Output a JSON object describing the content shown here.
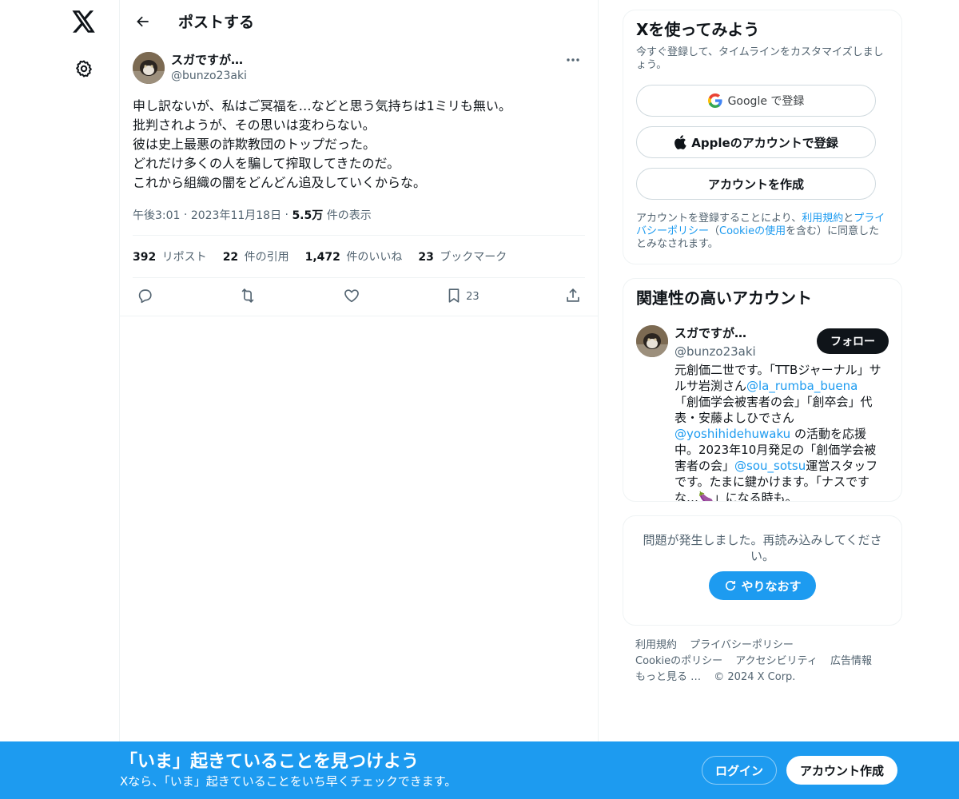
{
  "nav": {
    "logo_icon": "x-logo-icon",
    "settings_icon": "gear-icon"
  },
  "header": {
    "title": "ポストする"
  },
  "post": {
    "display_name": "スガですが…",
    "handle": "@bunzo23aki",
    "body": "申し訳ないが、私はご冥福を…などと思う気持ちは1ミリも無い。\n批判されようが、その思いは変わらない。\n彼は史上最悪の詐欺教団のトップだった。\nどれだけ多くの人を騙して搾取してきたのだ。\nこれから組織の闇をどんどん追及していくからな。",
    "time": "午後3:01",
    "date": "2023年11月18日",
    "views_value": "5.5万",
    "views_label": "件の表示",
    "reposts_value": "392",
    "reposts_label": "リポスト",
    "quotes_value": "22",
    "quotes_label": "件の引用",
    "likes_value": "1,472",
    "likes_label": "件のいいね",
    "bookmarks_value": "23",
    "bookmarks_label": "ブックマーク",
    "bookmark_action_count": "23"
  },
  "signup": {
    "title": "Xを使ってみよう",
    "subtitle": "今すぐ登録して、タイムラインをカスタマイズしましょう。",
    "google_label": "Google で登録",
    "apple_label": "Appleのアカウントで登録",
    "create_label": "アカウントを作成",
    "legal_1": "アカウントを登録することにより、",
    "legal_terms": "利用規約",
    "legal_and": "と",
    "legal_privacy": "プライバシーポリシー",
    "legal_open": "（",
    "legal_cookie": "Cookieの使用",
    "legal_2": "を含む）に同意したとみなされます。"
  },
  "related": {
    "title": "関連性の高いアカウント",
    "name": "スガですが…",
    "handle": "@bunzo23aki",
    "follow_label": "フォロー",
    "bio_1": "元創価二世です。「TTBジャーナル」サルサ岩渕さん",
    "bio_mention_1": "@la_rumba_buena",
    "bio_2": " 「創価学会被害者の会」「創卒会」代表・安藤よしひでさん",
    "bio_mention_2": "@yoshihidehuwaku",
    "bio_3": " の活動を応援中。2023年10月発足の「創価学会被害者の会」",
    "bio_mention_3": "@sou_sotsu",
    "bio_4": "運営スタッフです。たまに鍵かけます。「ナスですな…🍆」になる時も。"
  },
  "error": {
    "message": "問題が発生しました。再読み込みしてください。",
    "retry_label": "やりなおす"
  },
  "footer": {
    "terms": "利用規約",
    "privacy": "プライバシーポリシー",
    "cookie": "Cookieのポリシー",
    "accessibility": "アクセシビリティ",
    "ads": "広告情報",
    "more": "もっと見る …",
    "copyright": "© 2024 X Corp."
  },
  "banner": {
    "title": "「いま」起きていることを見つけよう",
    "subtitle": "Xなら、「いま」起きていることをいち早くチェックできます。",
    "login_label": "ログイン",
    "signup_label": "アカウント作成"
  },
  "colors": {
    "accent": "#1d9bf0",
    "text": "#0f1419",
    "secondary": "#536471"
  }
}
